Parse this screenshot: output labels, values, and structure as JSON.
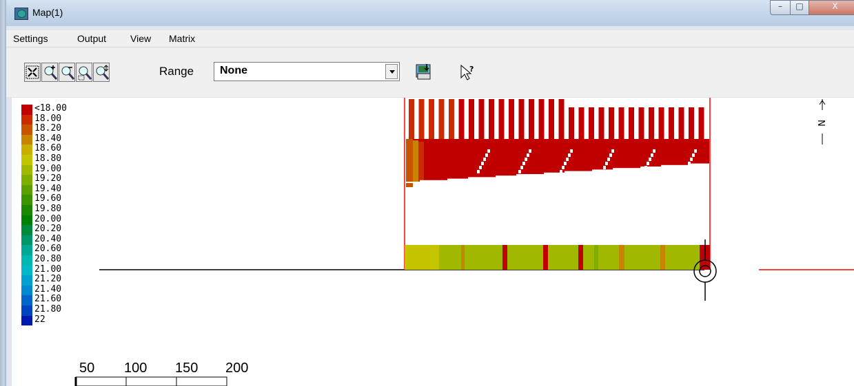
{
  "window": {
    "title": "Map(1)",
    "controls": {
      "minimize": "–",
      "maximize": "□",
      "close": "X"
    }
  },
  "menu": {
    "items": [
      "Settings",
      "Output",
      "View",
      "Matrix"
    ]
  },
  "toolbar": {
    "zoom_buttons": [
      "zoom-extents-icon",
      "zoom-in-icon",
      "zoom-out-icon",
      "zoom-window-icon",
      "zoom-pan-icon"
    ],
    "range_label": "Range",
    "range_value": "None",
    "export_icon": "export-icon",
    "pointer_help_icon": "pointer-help-icon"
  },
  "legend": {
    "entries": [
      {
        "label": "<18.00",
        "color": "#c00000"
      },
      {
        "label": "18.00",
        "color": "#cc2a00"
      },
      {
        "label": "18.20",
        "color": "#c85400"
      },
      {
        "label": "18.40",
        "color": "#c88400"
      },
      {
        "label": "18.60",
        "color": "#c8b000"
      },
      {
        "label": "18.80",
        "color": "#c4c400"
      },
      {
        "label": "19.00",
        "color": "#a0b800"
      },
      {
        "label": "19.20",
        "color": "#7fae00"
      },
      {
        "label": "19.40",
        "color": "#5aa000"
      },
      {
        "label": "19.60",
        "color": "#3a9400"
      },
      {
        "label": "19.80",
        "color": "#1a8800"
      },
      {
        "label": "20.00",
        "color": "#008000"
      },
      {
        "label": "20.20",
        "color": "#008a3c"
      },
      {
        "label": "20.40",
        "color": "#00966c"
      },
      {
        "label": "20.60",
        "color": "#00a894"
      },
      {
        "label": "20.80",
        "color": "#00b8b0"
      },
      {
        "label": "21.00",
        "color": "#00b8c8"
      },
      {
        "label": "21.20",
        "color": "#00a0d0"
      },
      {
        "label": "21.40",
        "color": "#0088d0"
      },
      {
        "label": "21.60",
        "color": "#0066cc"
      },
      {
        "label": "21.80",
        "color": "#0044c0"
      },
      {
        "label": "22",
        "color": "#0018b0"
      }
    ]
  },
  "scale_bar": {
    "labels": [
      "50",
      "100",
      "150",
      "200"
    ]
  },
  "north_label": "↑ N ↑",
  "map_colors": {
    "axis": "#000000",
    "boundary": "#ff0000",
    "grid_bg": "#ffffff"
  }
}
